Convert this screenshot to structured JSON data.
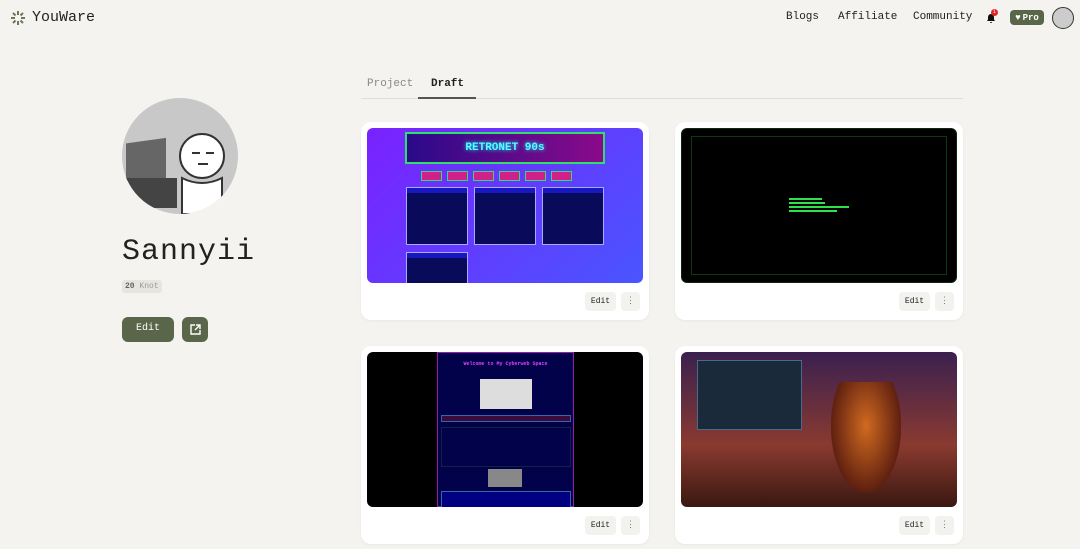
{
  "header": {
    "brand": "YouWare",
    "nav": [
      "Blogs",
      "Affiliate",
      "Community"
    ],
    "notification_count": "1",
    "pro_label": "Pro"
  },
  "profile": {
    "name": "Sannyii",
    "knot_count": "20",
    "knot_label": "Knot",
    "edit_label": "Edit"
  },
  "tabs": [
    {
      "label": "Project",
      "active": false
    },
    {
      "label": "Draft",
      "active": true
    }
  ],
  "cards": [
    {
      "thumb_title": "RETRONET 90s",
      "edit_label": "Edit",
      "more_label": "⋮"
    },
    {
      "edit_label": "Edit",
      "more_label": "⋮"
    },
    {
      "thumb_title": "Welcome to My Cyberweb Space",
      "edit_label": "Edit",
      "more_label": "⋮"
    },
    {
      "edit_label": "Edit",
      "more_label": "⋮"
    }
  ],
  "colors": {
    "accent": "#5a6649",
    "background": "#f4f3ef"
  }
}
